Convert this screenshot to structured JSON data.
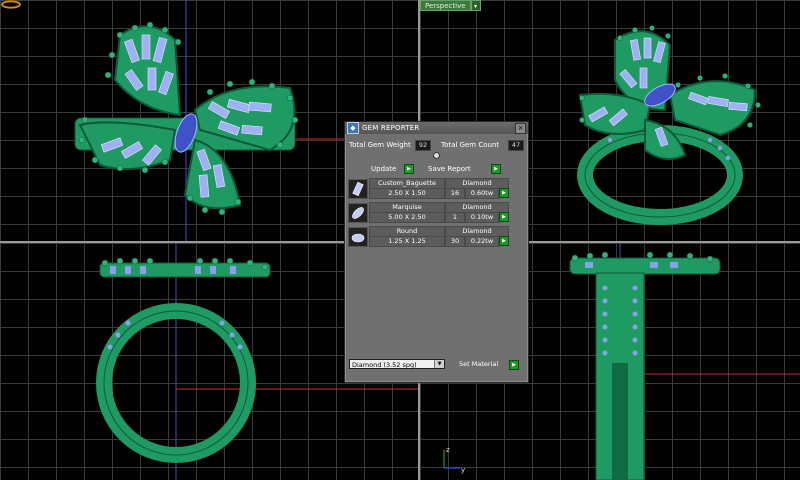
{
  "viewport": {
    "perspective_label": "Perspective",
    "axis_z": "z",
    "axis_y": "y"
  },
  "gem_reporter": {
    "title": "GEM REPORTER",
    "total_weight_label": "Total Gem Weight",
    "total_weight_value": "92",
    "total_count_label": "Total Gem Count",
    "total_count_value": "47",
    "update_label": "Update",
    "save_report_label": "Save Report",
    "gems": [
      {
        "name": "Custom_Baguette",
        "material": "Diamond",
        "size": "2.50 X 1.50",
        "count": "16",
        "weight": "0.60tw"
      },
      {
        "name": "Marquise",
        "material": "Diamond",
        "size": "5.00 X 2.50",
        "count": "1",
        "weight": "0.10tw"
      },
      {
        "name": "Round",
        "material": "Diamond",
        "size": "1.25 X 1.25",
        "count": "30",
        "weight": "0.22tw"
      }
    ],
    "material_select": "Diamond     (3.52 spg)",
    "set_material_label": "Set Material"
  },
  "colors": {
    "model_green": "#1f9a63",
    "gem_blue": "#8aa0ef",
    "panel_bg": "#707070",
    "go_button": "#1e9a2a"
  }
}
